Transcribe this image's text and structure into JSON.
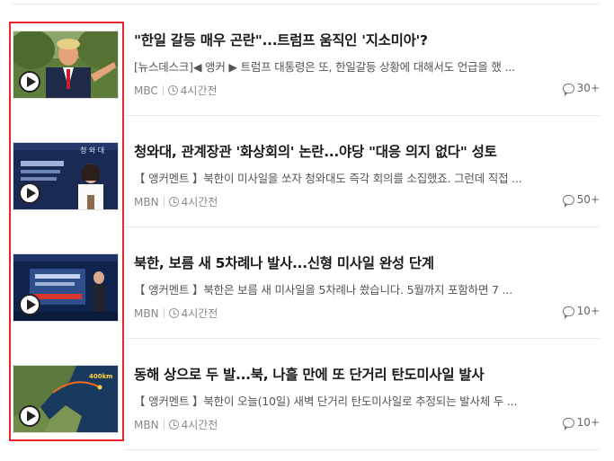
{
  "news": [
    {
      "title": "\"한일 갈등 매우 곤란\"...트럼프 움직인 '지소미아'?",
      "summary": "[뉴스데스크]◀ 앵커 ▶ 트럼프 대통령은 또, 한일갈등 상황에 대해서도 언급을 했 ...",
      "source": "MBC",
      "time": "4시간전",
      "comments": "30+",
      "thumb_icon": "trump-photo"
    },
    {
      "title": "청와대, 관계장관 '화상회의' 논란...야당 \"대응 의지 없다\" 성토",
      "summary": "【 앵커멘트 】북한이 미사일을 쏘자 청와대도 즉각 회의를 소집했죠. 그런데 직접 ...",
      "source": "MBN",
      "time": "4시간전",
      "comments": "50+",
      "thumb_icon": "briefing-photo",
      "thumb_caption": "청 와 대"
    },
    {
      "title": "북한, 보름 새 5차례나 발사...신형 미사일 완성 단계",
      "summary": "【 앵커멘트 】북한은 보름 새 미사일을 5차례나 쐈습니다. 5월까지 포함하면 7 ...",
      "source": "MBN",
      "time": "4시간전",
      "comments": "10+",
      "thumb_icon": "anchor-screen-photo"
    },
    {
      "title": "동해 상으로 두 발...북, 나흘 만에 또 단거리 탄도미사일 발사",
      "summary": "【 앵커멘트 】북한이 오늘(10일) 새벽 단거리 탄도미사일로 추정되는 발사체 두 ...",
      "source": "MBN",
      "time": "4시간전",
      "comments": "10+",
      "thumb_icon": "map-photo",
      "thumb_caption": "400km"
    }
  ],
  "colors": {
    "highlight": "#e8252c",
    "title": "#1a1a1a",
    "meta": "#888888"
  }
}
